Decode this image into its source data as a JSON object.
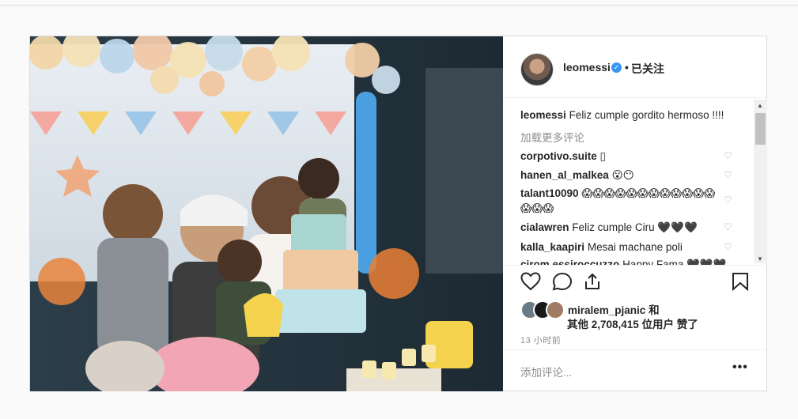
{
  "post": {
    "username": "leomessi",
    "separator": "•",
    "follow_label": "已关注",
    "caption": {
      "user": "leomessi",
      "text": "Feliz cumple gordito hermoso !!!!"
    },
    "load_more": "加载更多评论",
    "comments": [
      {
        "user": "corpotivo.suite",
        "text": "▯"
      },
      {
        "user": "hanen_al_malkea",
        "text": "😮😶"
      },
      {
        "user": "talant10090",
        "text": "😱😱😱😱😱😱😱😱😱😱😱😱",
        "text2": "😱😱😱"
      },
      {
        "user": "cialawren",
        "text": "Feliz cumple Ciru 🖤🖤🖤"
      },
      {
        "user": "kalla_kaapiri",
        "text": "Mesai machane poli"
      },
      {
        "user": "cirom essiroccuzzo",
        "text": "Happy Fama 🖤🖤🖤"
      }
    ],
    "likes": {
      "first_liker": "miralem_pjanic",
      "and": "和",
      "rest": "其他 2,708,415 位用户 赞了"
    },
    "time": "13 小时前",
    "add_comment_placeholder": "添加评论...",
    "options": "•••"
  },
  "icons": [
    "heart-icon",
    "comment-icon",
    "share-icon",
    "bookmark-icon",
    "verified-icon",
    "options-icon"
  ],
  "colors": {
    "verified": "#3897f0",
    "muted": "#8e8e8e",
    "border": "#dbdbdb"
  }
}
